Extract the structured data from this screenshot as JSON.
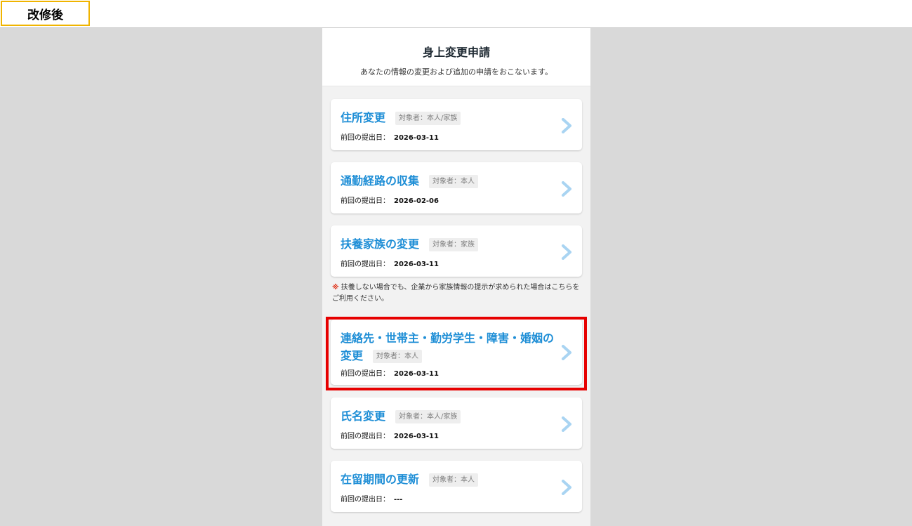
{
  "version_label": "改修後",
  "header": {
    "title": "身上変更申請",
    "subtitle": "あなたの情報の変更および追加の申請をおこないます。"
  },
  "date_prefix": "前回の提出日：",
  "items": [
    {
      "title": "住所変更",
      "badge": "対象者：本人/家族",
      "date": "2026-03-11"
    },
    {
      "title": "通勤経路の収集",
      "badge": "対象者：本人",
      "date": "2026-02-06"
    },
    {
      "title": "扶養家族の変更",
      "badge": "対象者：家族",
      "date": "2026-03-11"
    },
    {
      "title_line1": "連絡先・世帯主・勤労学生・障害・婚姻の",
      "title_line2": "変更",
      "badge": "対象者：本人",
      "date": "2026-03-11"
    },
    {
      "title": "氏名変更",
      "badge": "対象者：本人/家族",
      "date": "2026-03-11"
    },
    {
      "title": "在留期間の更新",
      "badge": "対象者：本人",
      "date": "---"
    }
  ],
  "note": {
    "mark": "※",
    "text": "扶養しない場合でも、企業から家族情報の提示が求められた場合はこちらをご利用ください。"
  },
  "icons": {
    "chevron": "chevron-right-icon"
  },
  "colors": {
    "title_blue": "#1e8ed6",
    "highlight_red": "#e60000",
    "label_border": "#f0b400",
    "note_mark": "#e0341b"
  }
}
